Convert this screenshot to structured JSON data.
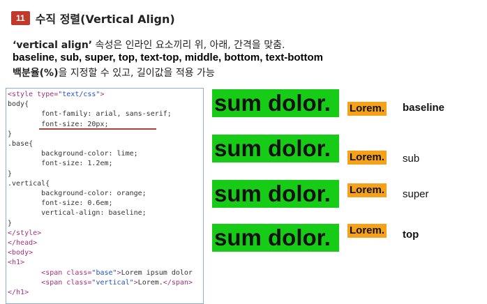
{
  "header": {
    "badge": "11",
    "title": "수직 정렬(Vertical Align)"
  },
  "desc": {
    "kw": "‘vertical align’",
    "text1": " 속성은 인라인 요소끼리 위, 아래, 간격을 맞춤.",
    "values": "baseline, sub, super, top, text-top, middle, bottom, text-bottom",
    "pct_bold": "백분율(%)",
    "pct_rest": "을 지정할 수 있고, 길이값을 적용 가능"
  },
  "code": {
    "l1_tag": "<style ",
    "l1_attr": "type=",
    "l1_val": "\"text/css\"",
    "l1_end": ">",
    "l2": "body{",
    "l3": "        font-family: arial, sans-serif;",
    "l4": "        font-size: 20px;",
    "l5": "}",
    "l6": ".base{",
    "l7": "        background-color: lime;",
    "l8": "        font-size: 1.2em;",
    "l9": "}",
    "l10": ".vertical{",
    "l11": "        background-color: orange;",
    "l12": "        font-size: 0.6em;",
    "l13": "        vertical-align: baseline;",
    "l14": "}",
    "l15": "</style>",
    "l16": "</head>",
    "l17": "<body>",
    "l18": "",
    "l19": "<h1>",
    "l20_pre": "        ",
    "l20_tag": "<span ",
    "l20_attr": "class=",
    "l20_val": "\"base\"",
    "l20_end": ">",
    "l20_text": "Lorem ipsum dolor",
    "l21_pre": "        ",
    "l21_tag": "<span ",
    "l21_attr": "class=",
    "l21_val": "\"vertical\"",
    "l21_end": ">",
    "l21_text": "Lorem.",
    "l21_close": "</span>",
    "l22": "</h1>"
  },
  "demo": {
    "base_text": "sum dolor.",
    "vertical_text": "Lorem.",
    "rows": [
      {
        "label": "baseline"
      },
      {
        "label": "sub"
      },
      {
        "label": "super"
      },
      {
        "label": "top"
      }
    ]
  }
}
